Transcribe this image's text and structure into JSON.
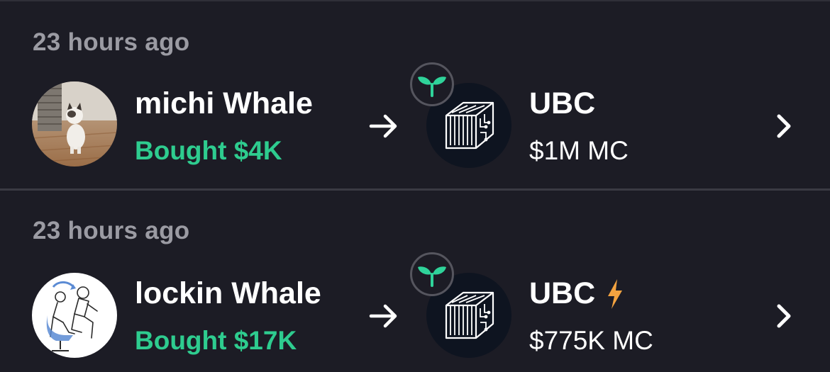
{
  "activities": [
    {
      "timestamp": "23 hours ago",
      "wallet_name": "michi Whale",
      "trade": "Bought $4K",
      "token": {
        "ticker": "UBC",
        "market_cap": "$1M MC",
        "badge_icon": "sprout-icon",
        "logo_icon": "circuit-cube-icon",
        "boosted": false
      },
      "avatar": "cat-photo"
    },
    {
      "timestamp": "23 hours ago",
      "wallet_name": "lockin Whale",
      "trade": "Bought $17K",
      "token": {
        "ticker": "UBC",
        "market_cap": "$775K MC",
        "badge_icon": "sprout-icon",
        "logo_icon": "circuit-cube-icon",
        "boosted": true,
        "boost_icon": "lightning-bolt-icon"
      },
      "avatar": "sketch-man-in-chair"
    }
  ],
  "colors": {
    "background": "#1c1c25",
    "buy_green": "#2ecc8f",
    "muted_text": "#9b9ba3",
    "bolt_orange": "#f4a340",
    "sprout_green": "#2fd39a"
  }
}
